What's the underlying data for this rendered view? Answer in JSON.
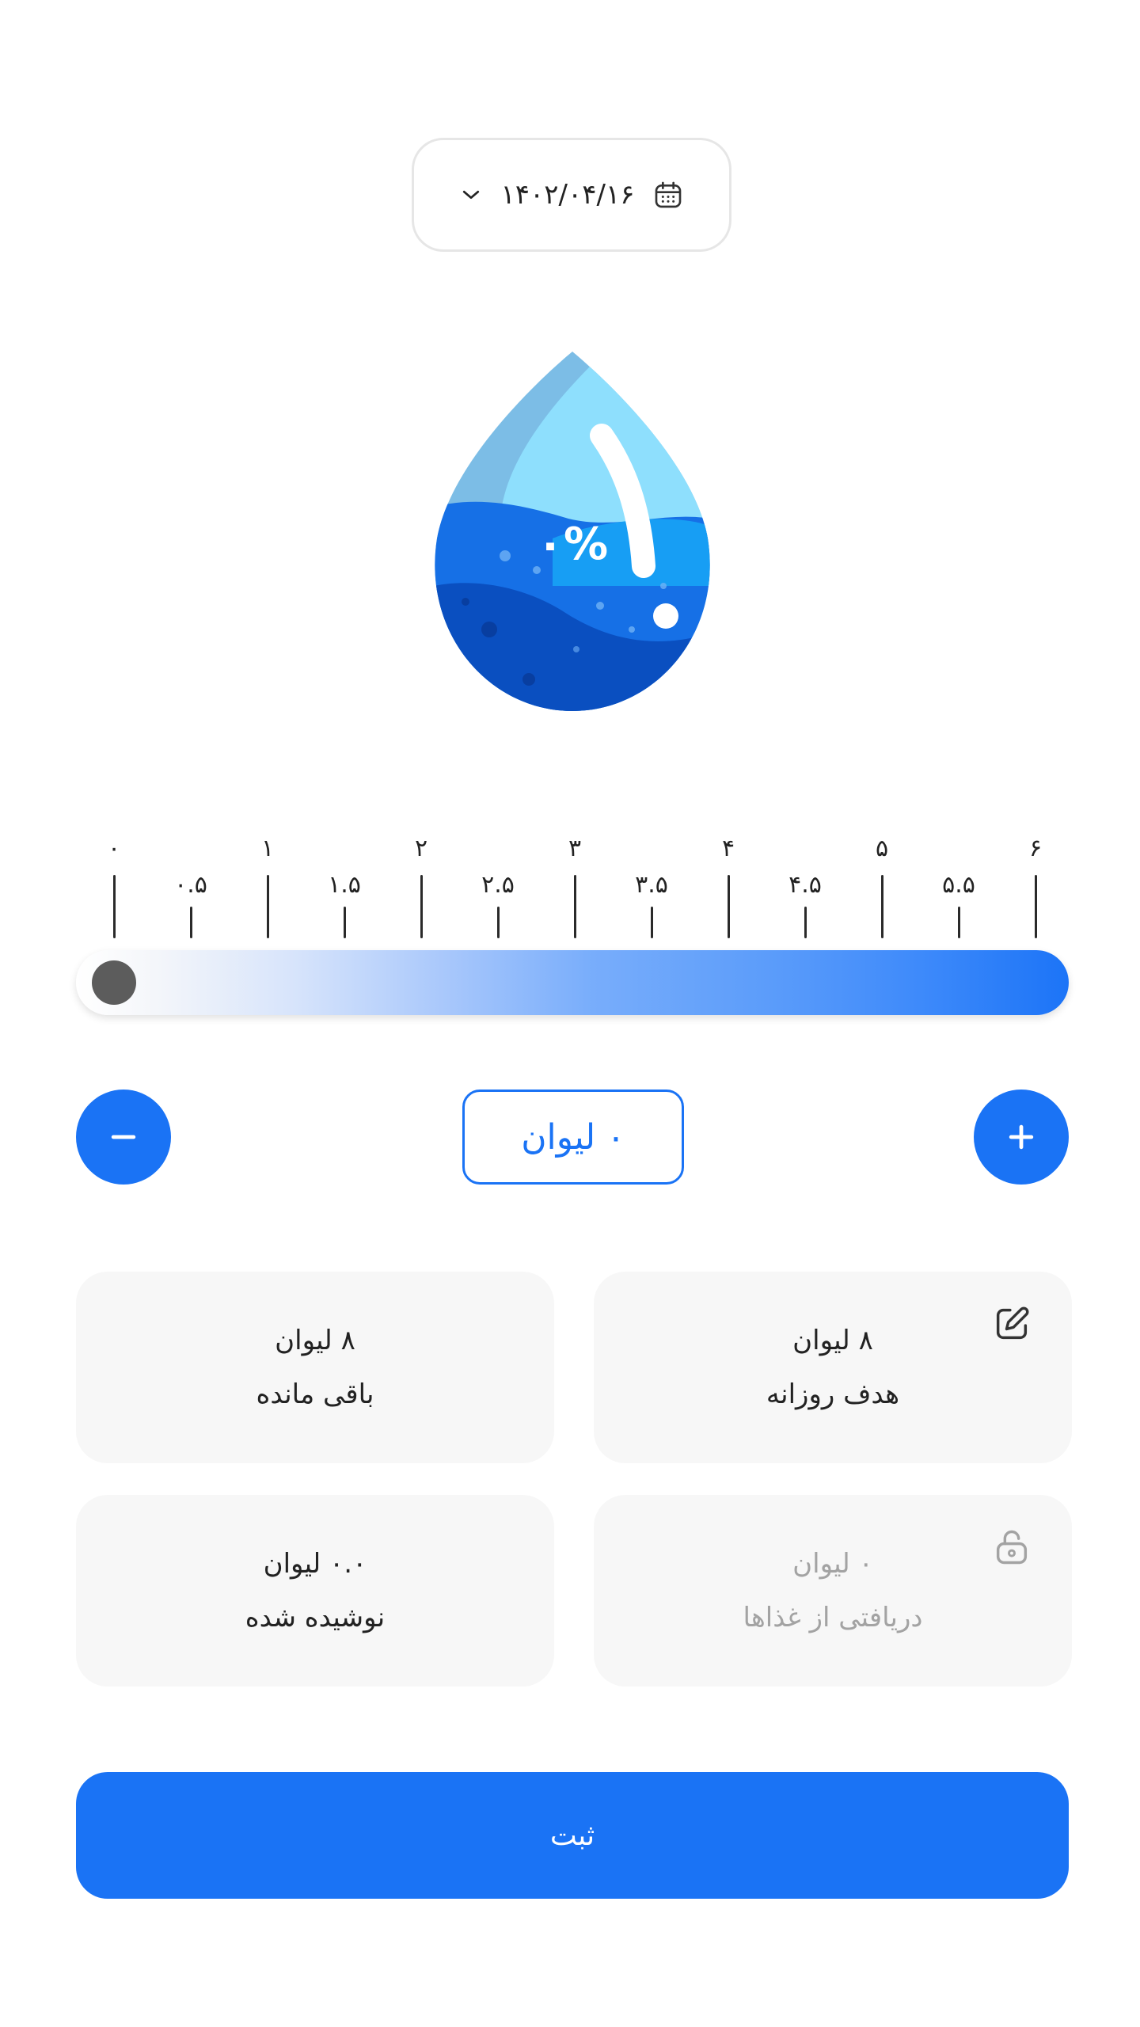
{
  "date_picker": {
    "date": "۱۴۰۲/۰۴/۱۶",
    "calendar_icon": "calendar-icon",
    "chevron_icon": "chevron-down-icon"
  },
  "water_drop": {
    "percent": "۰%"
  },
  "ruler": {
    "ticks": [
      {
        "label": "۰",
        "value": 0,
        "major": true
      },
      {
        "label": "۰.۵",
        "value": 0.5,
        "major": false
      },
      {
        "label": "۱",
        "value": 1,
        "major": true
      },
      {
        "label": "۱.۵",
        "value": 1.5,
        "major": false
      },
      {
        "label": "۲",
        "value": 2,
        "major": true
      },
      {
        "label": "۲.۵",
        "value": 2.5,
        "major": false
      },
      {
        "label": "۳",
        "value": 3,
        "major": true
      },
      {
        "label": "۳.۵",
        "value": 3.5,
        "major": false
      },
      {
        "label": "۴",
        "value": 4,
        "major": true
      },
      {
        "label": "۴.۵",
        "value": 4.5,
        "major": false
      },
      {
        "label": "۵",
        "value": 5,
        "major": true
      },
      {
        "label": "۵.۵",
        "value": 5.5,
        "major": false
      },
      {
        "label": "۶",
        "value": 6,
        "major": true
      }
    ]
  },
  "slider": {
    "value": 0,
    "max": 6,
    "thumb_color": "#5c5c5c"
  },
  "stepper": {
    "value_label": "۰ لیوان",
    "minus_icon": "minus-icon",
    "plus_icon": "plus-icon"
  },
  "cards": {
    "daily_goal": {
      "value": "۸ لیوان",
      "label": "هدف روزانه",
      "icon": "edit-icon"
    },
    "remaining": {
      "value": "۸ لیوان",
      "label": "باقی مانده"
    },
    "from_food": {
      "value": "۰ لیوان",
      "label": "دریافتی از غذاها",
      "icon": "lock-icon"
    },
    "drunk": {
      "value": "۰.۰ لیوان",
      "label": "نوشیده شده"
    }
  },
  "submit": {
    "label": "ثبت"
  },
  "colors": {
    "primary": "#1a73f5",
    "card_bg": "#f7f7f7",
    "disabled_text": "#a3a3a3"
  }
}
